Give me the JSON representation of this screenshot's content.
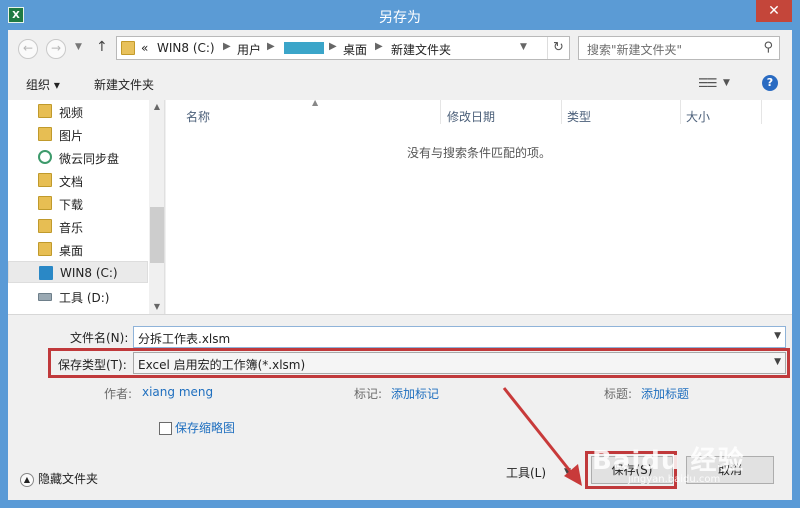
{
  "window": {
    "title": "另存为",
    "app_icon": "excel-icon"
  },
  "address": {
    "overflow": "«",
    "crumbs": [
      "WIN8 (C:)",
      "用户",
      "桌面",
      "新建文件夹"
    ],
    "search_placeholder": "搜索\"新建文件夹\""
  },
  "toolbar": {
    "organize": "组织 ▾",
    "new_folder": "新建文件夹"
  },
  "nav": {
    "items": [
      {
        "label": "视频",
        "icon": "folder-video-icon"
      },
      {
        "label": "图片",
        "icon": "folder-picture-icon"
      },
      {
        "label": "微云同步盘",
        "icon": "weiyun-cloud-icon"
      },
      {
        "label": "文档",
        "icon": "folder-document-icon"
      },
      {
        "label": "下载",
        "icon": "folder-download-icon"
      },
      {
        "label": "音乐",
        "icon": "folder-music-icon"
      },
      {
        "label": "桌面",
        "icon": "folder-desktop-icon"
      },
      {
        "label": "WIN8 (C:)",
        "icon": "system-drive-icon"
      },
      {
        "label": "工具 (D:)",
        "icon": "drive-icon"
      }
    ]
  },
  "files": {
    "columns": [
      "名称",
      "修改日期",
      "类型",
      "大小"
    ],
    "empty_message": "没有与搜索条件匹配的项。"
  },
  "form": {
    "filename_label": "文件名(N):",
    "filename_value": "分拆工作表.xlsm",
    "filetype_label": "保存类型(T):",
    "filetype_value": "Excel 启用宏的工作簿(*.xlsm)",
    "author_label": "作者:",
    "author_value": "xiang meng",
    "tags_label": "标记:",
    "tags_value": "添加标记",
    "title_label": "标题:",
    "title_value": "添加标题",
    "thumbnail_label": "保存缩略图"
  },
  "footer": {
    "hide_folders": "隐藏文件夹",
    "tools": "工具(L)",
    "save": "保存(S)",
    "cancel": "取消"
  },
  "colors": {
    "titlebar": "#5b9bd5",
    "highlight_frame": "#c0393b",
    "link": "#1f6fbf"
  },
  "watermark": {
    "main": "Baidu 经验",
    "sub": "jingyan.baidu.com"
  }
}
